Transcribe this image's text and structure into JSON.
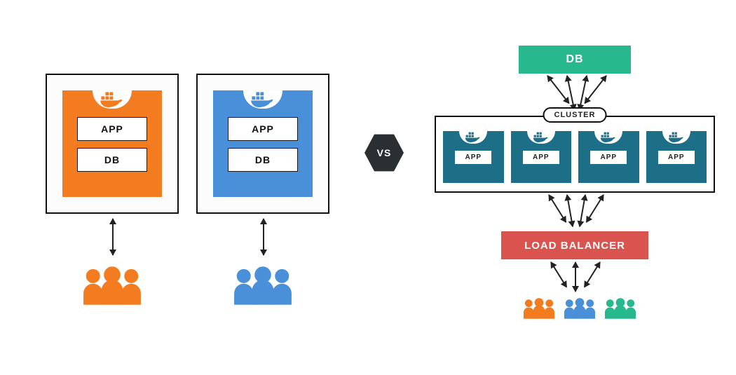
{
  "left_setup": {
    "orange": {
      "app_label": "APP",
      "db_label": "DB",
      "icon": "docker-whale-icon"
    },
    "blue": {
      "app_label": "APP",
      "db_label": "DB",
      "icon": "docker-whale-icon"
    }
  },
  "vs_label": "VS",
  "right_setup": {
    "db_label": "DB",
    "cluster_label": "CLUSTER",
    "apps": [
      "APP",
      "APP",
      "APP",
      "APP"
    ],
    "load_balancer_label": "LOAD BALANCER"
  },
  "colors": {
    "orange": "#f47c20",
    "blue": "#4a90d9",
    "teal": "#1d6e87",
    "green": "#27b88e",
    "red": "#d9534f",
    "dark_hex": "#2a2f33"
  }
}
